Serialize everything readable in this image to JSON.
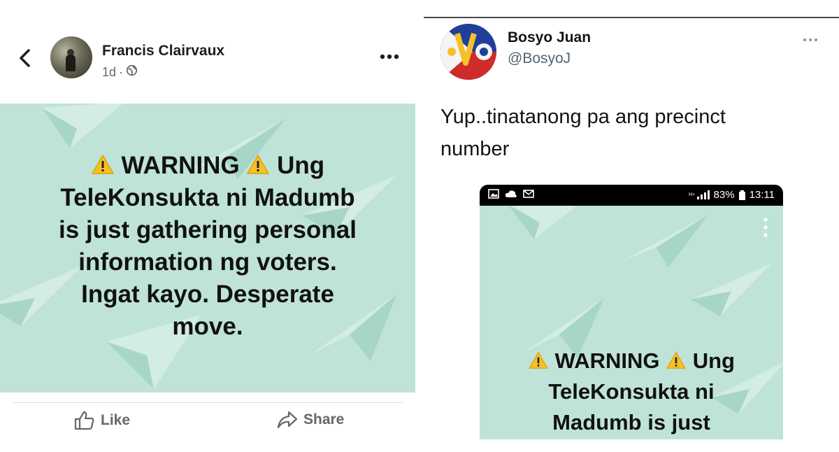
{
  "facebook_post": {
    "author": "Francis Clairvaux",
    "time": "1d",
    "warning_word": "WARNING",
    "card_lines_rest": [
      "Ung",
      "TeleKonsukta ni Madumb",
      "is just gathering personal",
      "information ng voters.",
      "Ingat kayo. Desperate",
      "move."
    ],
    "like_label": "Like",
    "share_label": "Share"
  },
  "tweet": {
    "name": "Bosyo Juan",
    "handle": "@BosyoJ",
    "text_line1": "Yup..tinatanong pa ang precinct",
    "text_line2": "number",
    "status_bar": {
      "battery": "83%",
      "time": "13:11"
    },
    "screenshot_lines": [
      "WARNING",
      "Ung",
      "TeleKonsukta ni",
      "Madumb is just"
    ]
  },
  "colors": {
    "card_background": "#bfe3d8",
    "warning_yellow": "#f6c02a"
  }
}
